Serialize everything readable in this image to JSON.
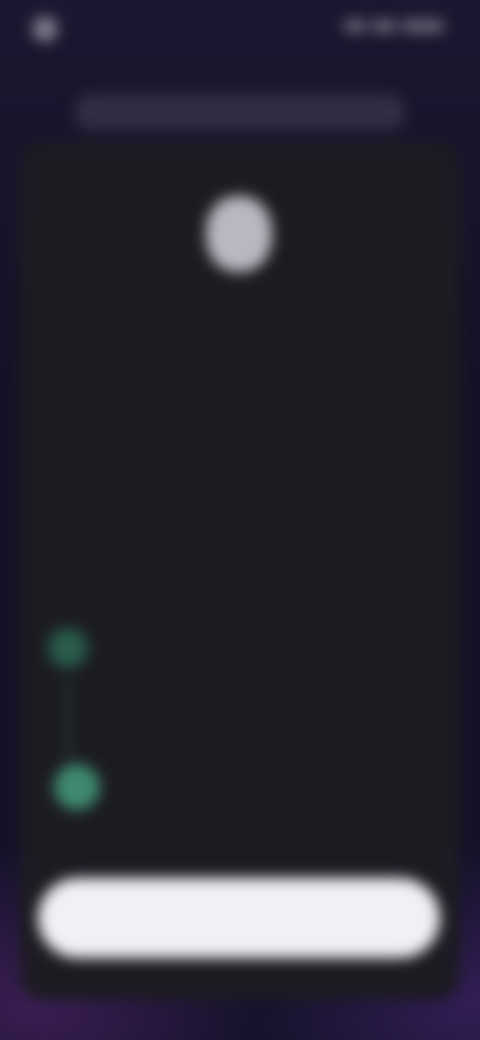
{
  "status_bar": {
    "left_text": "",
    "right_text": ""
  },
  "header": {
    "pill_text": ""
  },
  "card": {
    "title": "",
    "paragraph_1": "",
    "paragraph_2": "",
    "items": [
      {
        "text": "",
        "icon": "check-icon"
      },
      {
        "text": "",
        "icon": "check-icon"
      }
    ]
  },
  "cta": {
    "label": ""
  },
  "colors": {
    "background": "#141226",
    "card": "#1c1b22",
    "accent_green": "#3f8a6e",
    "button": "#f1f0f4"
  }
}
